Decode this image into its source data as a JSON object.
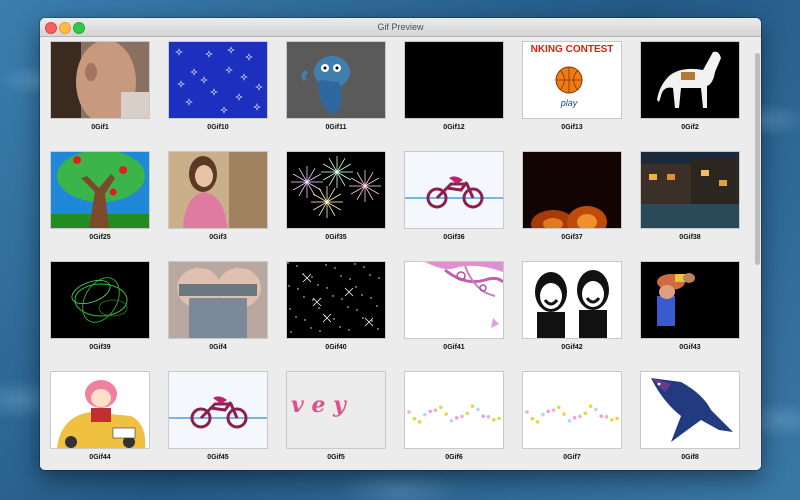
{
  "window": {
    "title": "Gif Preview"
  },
  "gifs": [
    {
      "label": "0Gif1",
      "icon": "person-photo"
    },
    {
      "label": "0Gif10",
      "icon": "blue-sparkles"
    },
    {
      "label": "0Gif11",
      "icon": "blue-monster"
    },
    {
      "label": "0Gif12",
      "icon": "black-frame"
    },
    {
      "label": "0Gif13",
      "icon": "basketball-contest",
      "text_top": "NKING CONTEST",
      "text_button": "play"
    },
    {
      "label": "0Gif2",
      "icon": "white-horse"
    },
    {
      "label": "0Gif25",
      "icon": "apple-tree"
    },
    {
      "label": "0Gif3",
      "icon": "girl-photo"
    },
    {
      "label": "0Gif35",
      "icon": "fireworks"
    },
    {
      "label": "0Gif36",
      "icon": "motorbike"
    },
    {
      "label": "0Gif37",
      "icon": "fire"
    },
    {
      "label": "0Gif38",
      "icon": "night-street"
    },
    {
      "label": "0Gif39",
      "icon": "green-spirals"
    },
    {
      "label": "0Gif4",
      "icon": "photo"
    },
    {
      "label": "0Gif40",
      "icon": "white-sparkles"
    },
    {
      "label": "0Gif41",
      "icon": "pink-swirls"
    },
    {
      "label": "0Gif42",
      "icon": "two-faces"
    },
    {
      "label": "0Gif43",
      "icon": "fighters"
    },
    {
      "label": "0Gif44",
      "icon": "cartoon-girl-car"
    },
    {
      "label": "0Gif45",
      "icon": "motorbike"
    },
    {
      "label": "0Gif5",
      "icon": "love-letters",
      "text": "v e y"
    },
    {
      "label": "0Gif6",
      "icon": "flower-dots"
    },
    {
      "label": "0Gif7",
      "icon": "flower-dots"
    },
    {
      "label": "0Gif8",
      "icon": "blue-bird"
    }
  ]
}
